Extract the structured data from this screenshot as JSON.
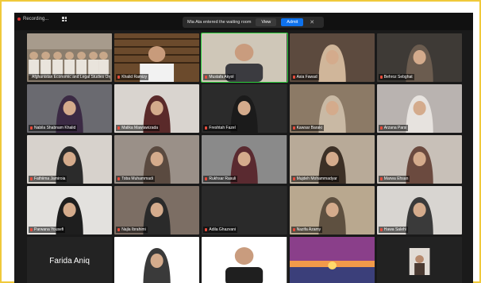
{
  "topbar": {
    "recording_label": "Recording...",
    "view_label": "View"
  },
  "waiting_room": {
    "message": "Mia Ata entered the waiting room",
    "view_button": "View",
    "admit_button": "Admit",
    "close_icon": "close-icon"
  },
  "colors": {
    "active_speaker": "#2dce3d",
    "admit": "#0e72ed",
    "muted_mic": "#e74c3c",
    "frame_border": "#f0c93a"
  },
  "participants": [
    {
      "name": "Afghanistan Economic and Legal Studies Organiz..."
    },
    {
      "name": "Khalid Ramizy"
    },
    {
      "name": "Mustafa Akyol"
    },
    {
      "name": "Asia Fawad"
    },
    {
      "name": "Behroz Sebghat"
    },
    {
      "name": "Nabila Shabnam Khalid"
    },
    {
      "name": "Malika Mawlawizada"
    },
    {
      "name": "Freshtah Fazel"
    },
    {
      "name": "Kawsar Baraki"
    },
    {
      "name": "Arzana Parsi"
    },
    {
      "name": "Fathiima Jamiroia"
    },
    {
      "name": "Toba Muhammadi"
    },
    {
      "name": "Rukhsar Rasuli"
    },
    {
      "name": "Mujdeh Mohammadyar"
    },
    {
      "name": "Marwa Ehsan"
    },
    {
      "name": "Parwana Yousefi"
    },
    {
      "name": "Najla Ibrahimi"
    },
    {
      "name": "Adila Ghazvani"
    },
    {
      "name": "Nazifa Azamy"
    },
    {
      "name": "Hawa Salehi"
    },
    {
      "name": "Farida Aniq"
    },
    {
      "name": ""
    },
    {
      "name": ""
    },
    {
      "name": ""
    },
    {
      "name": ""
    }
  ]
}
